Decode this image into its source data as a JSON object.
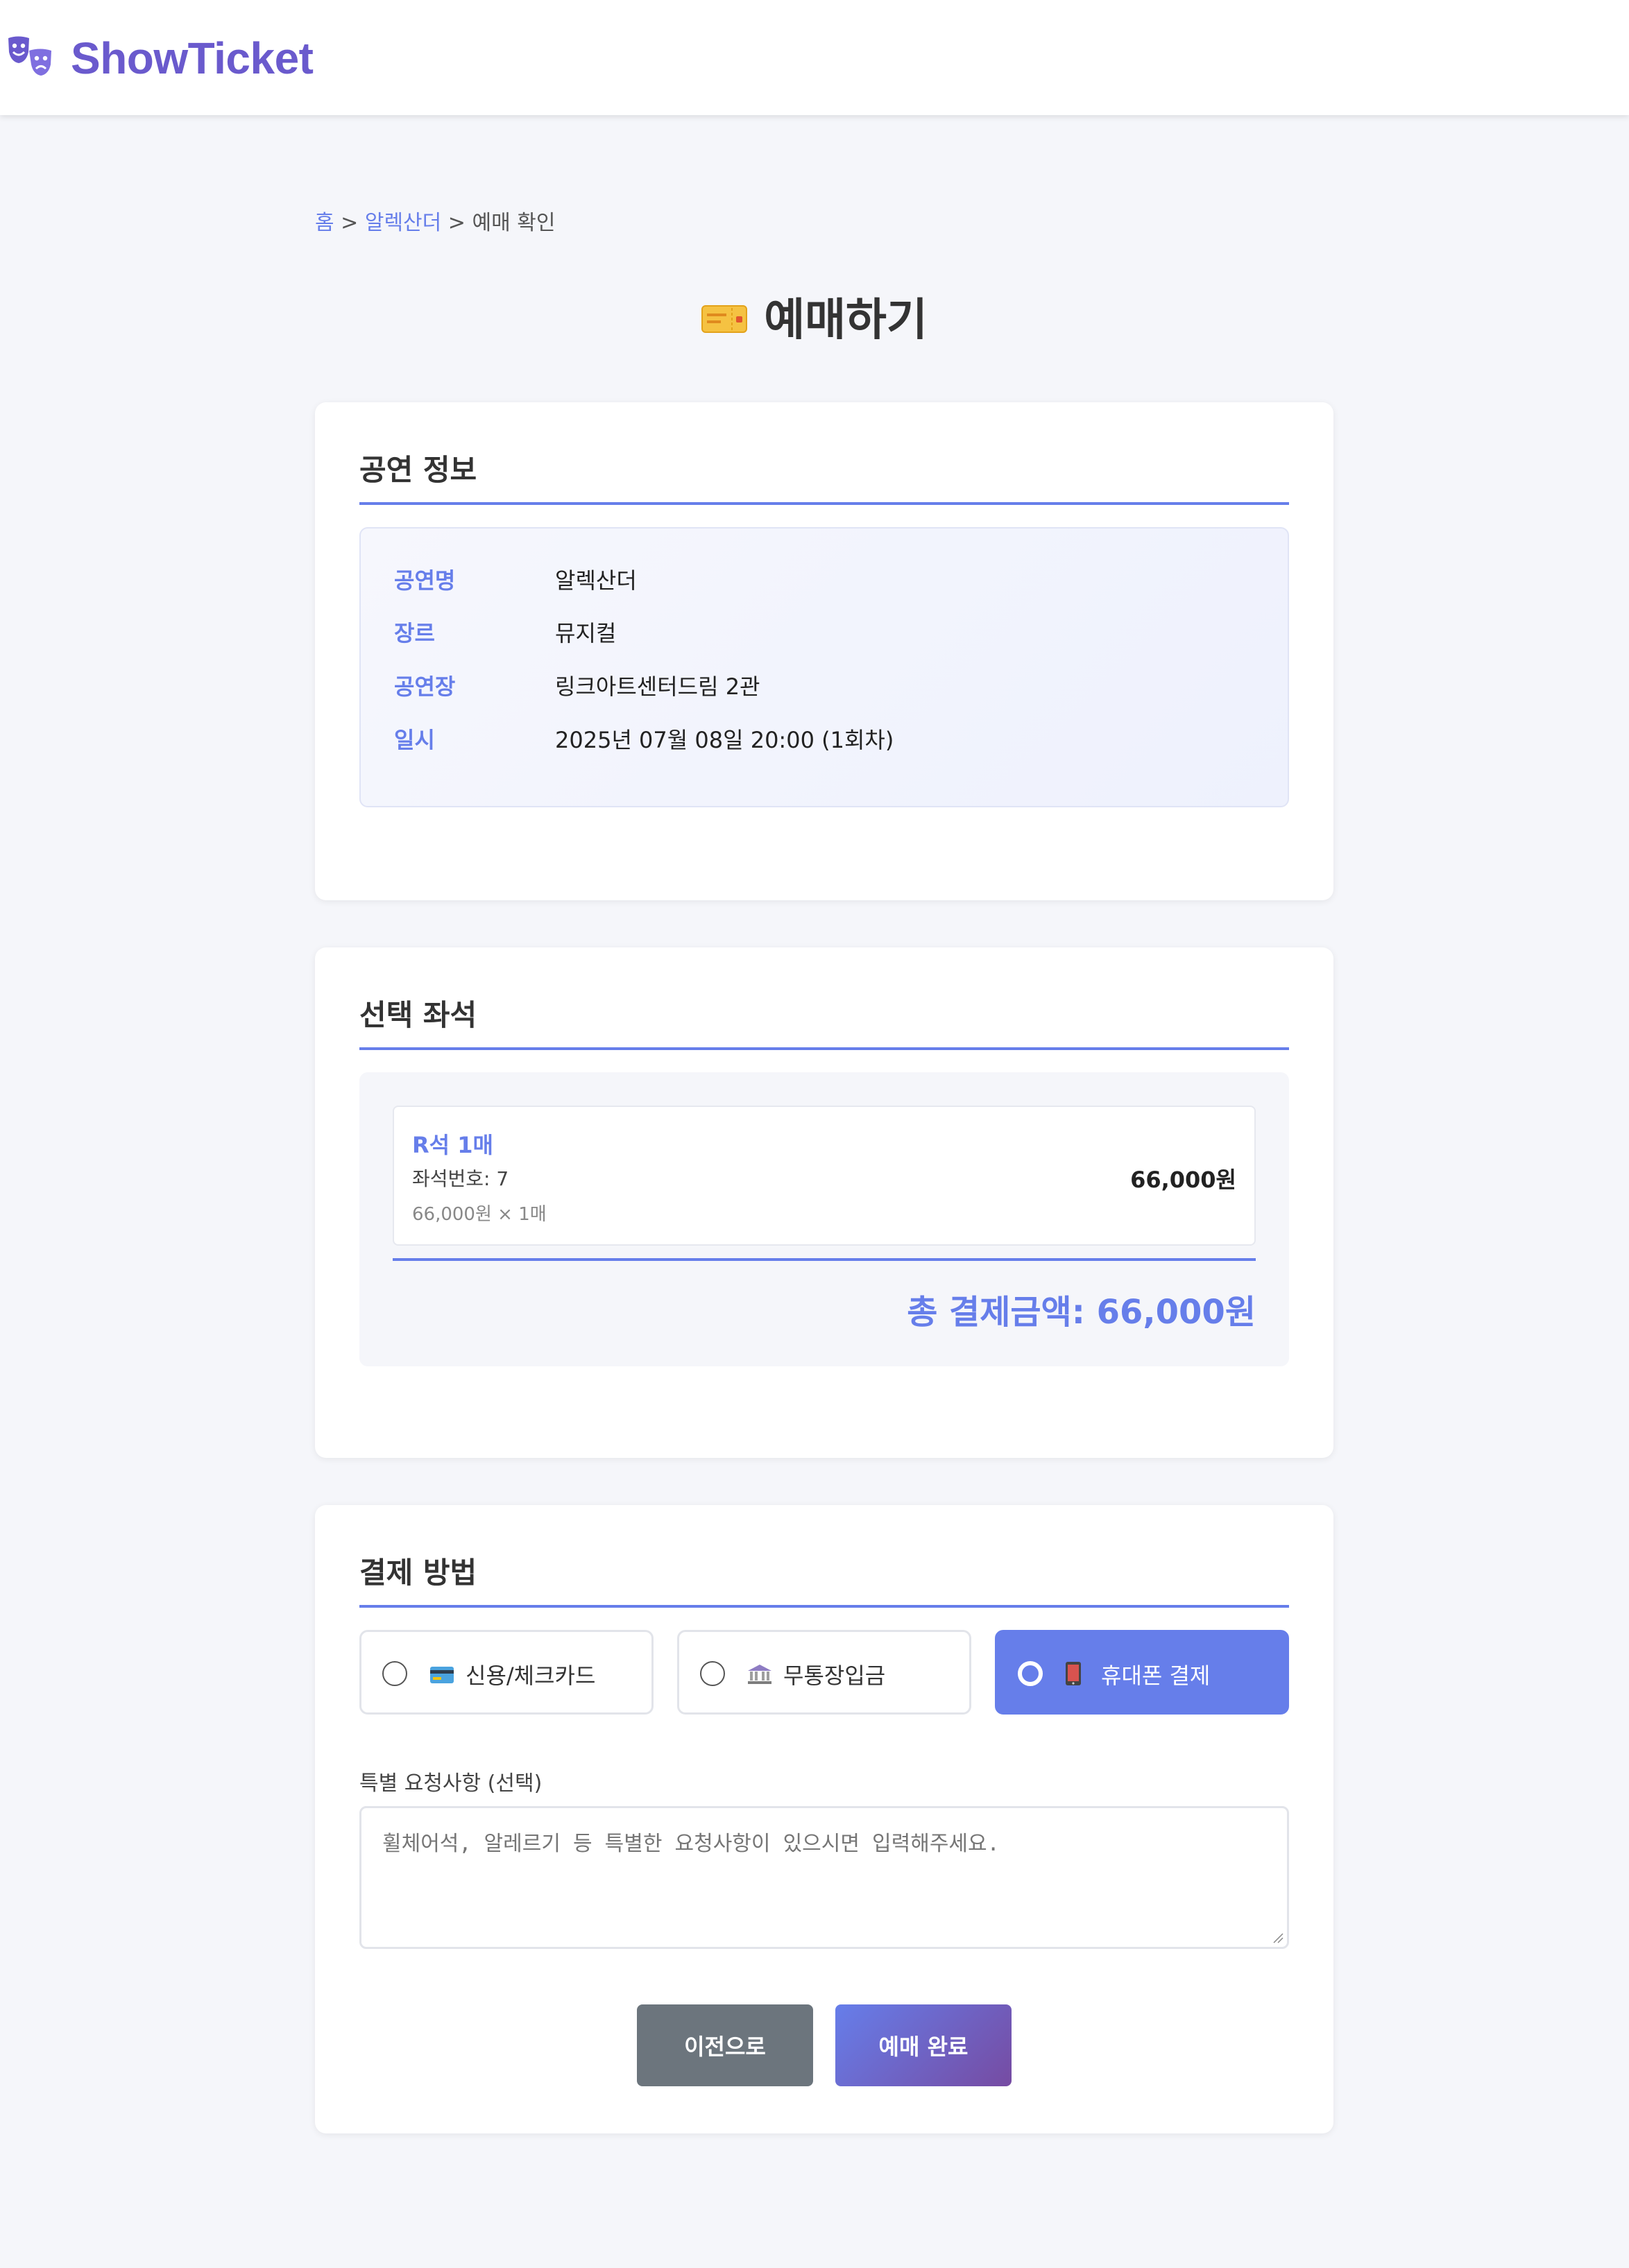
{
  "header": {
    "logo_text": "ShowTicket",
    "logo_icon": "theater-masks-icon"
  },
  "breadcrumb": {
    "home": "홈",
    "sep1": ">",
    "show": "알렉산더",
    "sep2": ">",
    "current": "예매 확인"
  },
  "page": {
    "title": "예매하기",
    "title_icon": "ticket-icon"
  },
  "show_info": {
    "title": "공연 정보",
    "rows": [
      {
        "label": "공연명",
        "value": "알렉산더"
      },
      {
        "label": "장르",
        "value": "뮤지컬"
      },
      {
        "label": "공연장",
        "value": "링크아트센터드림 2관"
      },
      {
        "label": "일시",
        "value": "2025년 07월 08일 20:00 (1회차)"
      }
    ]
  },
  "seats": {
    "title": "선택 좌석",
    "items": [
      {
        "grade": "R석 1매",
        "seat_number": "좌석번호: 7",
        "calc": "66,000원 × 1매",
        "price": "66,000원"
      }
    ],
    "total": "총 결제금액: 66,000원"
  },
  "payment": {
    "title": "결제 방법",
    "options": [
      {
        "label": "신용/체크카드",
        "icon": "credit-card-icon",
        "selected": false
      },
      {
        "label": "무통장입금",
        "icon": "bank-icon",
        "selected": false
      },
      {
        "label": "휴대폰 결제",
        "icon": "mobile-phone-icon",
        "selected": true
      }
    ],
    "request_label": "특별 요청사항 (선택)",
    "request_placeholder": "휠체어석, 알레르기 등 특별한 요청사항이 있으시면 입력해주세요.",
    "request_value": ""
  },
  "buttons": {
    "prev": "이전으로",
    "confirm": "예매 완료"
  },
  "colors": {
    "accent": "#667eea",
    "brand": "#6a5acd",
    "secondary_button": "#6c757d",
    "gradient_end": "#764ba2"
  }
}
